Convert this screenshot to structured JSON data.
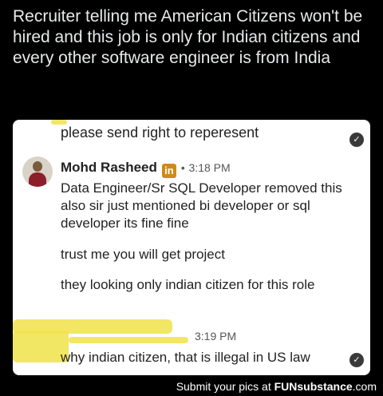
{
  "post": {
    "caption": "Recruiter telling me American Citizens won't be hired and this job is only for Indian citizens and every other software engineer is from India"
  },
  "chat": {
    "previous_message": "please send right to reperesent",
    "sender_name": "Mohd Rasheed",
    "linkedin_badge": "in",
    "separator": "•",
    "timestamp": "3:18 PM",
    "messages": [
      "Data Engineer/Sr SQL Developer removed this also sir just mentioned bi developer or sql developer  its fine fine",
      "trust me you will get project",
      "they looking only indian citizen for this role"
    ],
    "reply_timestamp": "3:19 PM",
    "reply_message": "why indian citizen, that is illegal in US law"
  },
  "watermark": {
    "prefix": "Submit your pics at ",
    "brand": "FUNsubstance",
    "suffix": ".com"
  },
  "colors": {
    "background": "#000000",
    "card": "#ffffff",
    "highlighter": "#f0e24a",
    "linkedin_badge": "#d08a1a"
  }
}
